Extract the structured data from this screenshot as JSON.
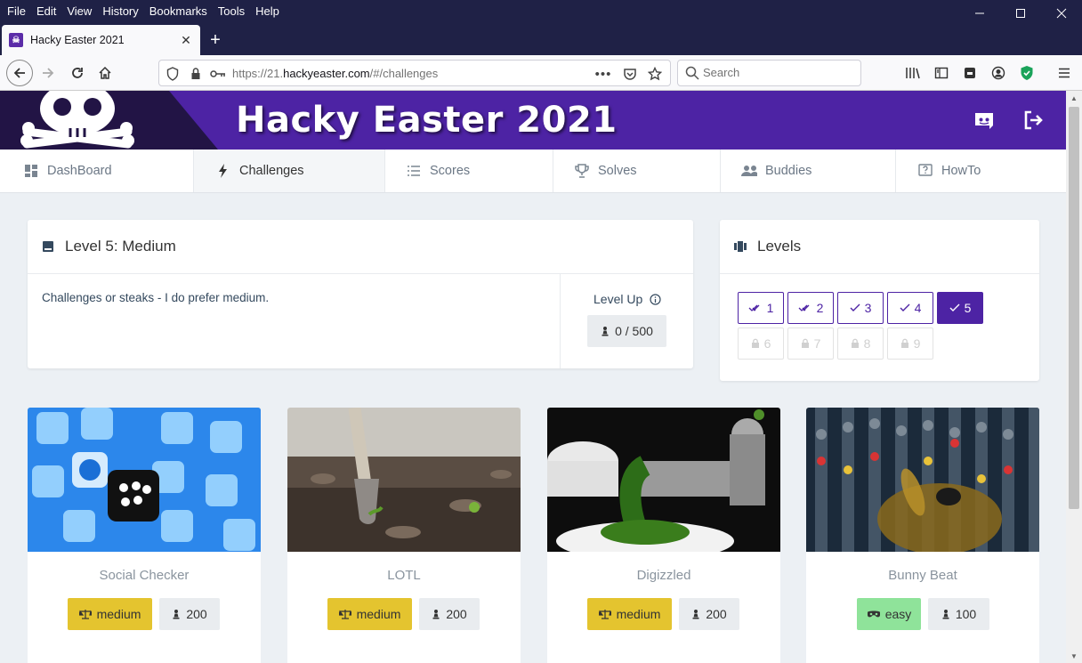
{
  "browser": {
    "menu": [
      "File",
      "Edit",
      "View",
      "History",
      "Bookmarks",
      "Tools",
      "Help"
    ],
    "tab_title": "Hacky Easter 2021",
    "url_prefix": "https://21.",
    "url_domain": "hackyeaster.com",
    "url_path": "/#/challenges",
    "search_placeholder": "Search"
  },
  "site": {
    "title": "Hacky Easter 2021",
    "nav": [
      "DashBoard",
      "Challenges",
      "Scores",
      "Solves",
      "Buddies",
      "HowTo"
    ],
    "active_nav": "Challenges"
  },
  "level_card": {
    "title": "Level 5: Medium",
    "description": "Challenges or steaks - I do prefer medium.",
    "level_up_label": "Level Up",
    "progress_text": "0 / 500",
    "progress_current": 0,
    "progress_total": 500
  },
  "levels_card": {
    "title": "Levels",
    "levels": [
      {
        "num": "1",
        "state": "double-check"
      },
      {
        "num": "2",
        "state": "double-check"
      },
      {
        "num": "3",
        "state": "check"
      },
      {
        "num": "4",
        "state": "check"
      },
      {
        "num": "5",
        "state": "active"
      },
      {
        "num": "6",
        "state": "locked"
      },
      {
        "num": "7",
        "state": "locked"
      },
      {
        "num": "8",
        "state": "locked"
      },
      {
        "num": "9",
        "state": "locked"
      }
    ]
  },
  "challenges": [
    {
      "name": "Social Checker",
      "difficulty": "medium",
      "points": "200",
      "image": "social-media-icons-image"
    },
    {
      "name": "LOTL",
      "difficulty": "medium",
      "points": "200",
      "image": "shovel-in-soil-image"
    },
    {
      "name": "Digizzled",
      "difficulty": "medium",
      "points": "200",
      "image": "meat-grinder-image"
    },
    {
      "name": "Bunny Beat",
      "difficulty": "easy",
      "points": "100",
      "image": "mixing-console-bunny-image"
    }
  ],
  "colors": {
    "brand_purple": "#4d23a4",
    "medium_badge": "#e4c42f",
    "easy_badge": "#8fe39a",
    "browser_chrome": "#1f2146"
  }
}
